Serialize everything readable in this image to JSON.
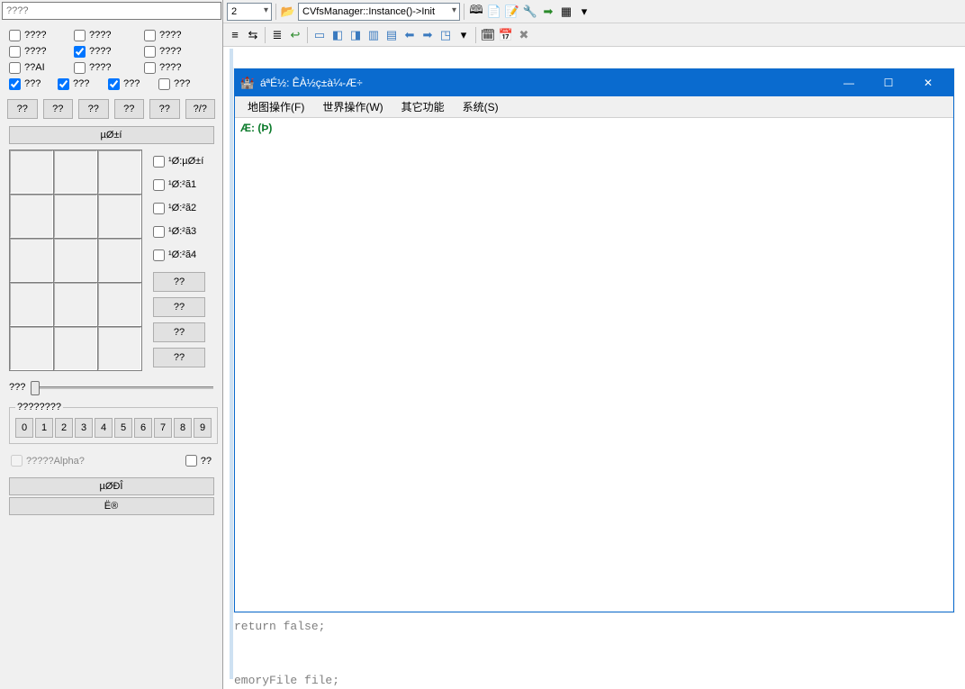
{
  "search": {
    "placeholder": "????"
  },
  "checks": {
    "r1": [
      "????",
      "????",
      "????"
    ],
    "r2": [
      "????",
      "????",
      "????"
    ],
    "r3": [
      "??AI",
      "????",
      "????"
    ],
    "r4": [
      "???",
      "???",
      "???",
      "???"
    ]
  },
  "checkStates": {
    "r1": [
      false,
      false,
      false
    ],
    "r2": [
      false,
      true,
      false
    ],
    "r3": [
      false,
      false,
      false
    ],
    "r4": [
      true,
      true,
      true,
      false
    ]
  },
  "btnRow": [
    "??",
    "??",
    "??",
    "??",
    "??",
    "?/?"
  ],
  "wideBtn1": "µØ±í",
  "sideChecks": [
    "¹Ø:µØ±í",
    "¹Ø:²ã1",
    "¹Ø:²ã2",
    "¹Ø:²ã3",
    "¹Ø:²ã4"
  ],
  "sideBtns": [
    "??",
    "??",
    "??",
    "??"
  ],
  "sliderLabel": "???",
  "numGroup": {
    "legend": "????????",
    "vals": [
      "0",
      "1",
      "2",
      "3",
      "4",
      "5",
      "6",
      "7",
      "8",
      "9"
    ]
  },
  "alpha": {
    "left": "?????Alpha?",
    "right": "??"
  },
  "wideBtn2": "µØÐÎ",
  "wideBtn3": "Ë®",
  "topbar": {
    "combo1": "2",
    "open_icon": "📂",
    "combo2": "CVfsManager::Instance()->Init",
    "icons": [
      "🕮",
      "📄",
      "📝",
      "🔧",
      "➡",
      "▦",
      "▾"
    ]
  },
  "secondbar": {
    "icons_a": [
      "≡",
      "⇆",
      "≣",
      "↩"
    ],
    "icons_b": [
      "▭",
      "◧",
      "◨",
      "▥",
      "▤",
      "⬅",
      "➡",
      "◳",
      "▾"
    ],
    "icons_c": [
      "🗓",
      "📅",
      "✖"
    ]
  },
  "appWindow": {
    "title": "áªÉ½: ÊÀ½ç±à¼­-Æ÷",
    "menus": [
      "地图操作(F)",
      "世界操作(W)",
      "其它功能",
      "系统(S)"
    ],
    "status": "Æ: (Þ)"
  },
  "code": {
    "line1": "return false;",
    "line2": "emoryFile file;"
  }
}
